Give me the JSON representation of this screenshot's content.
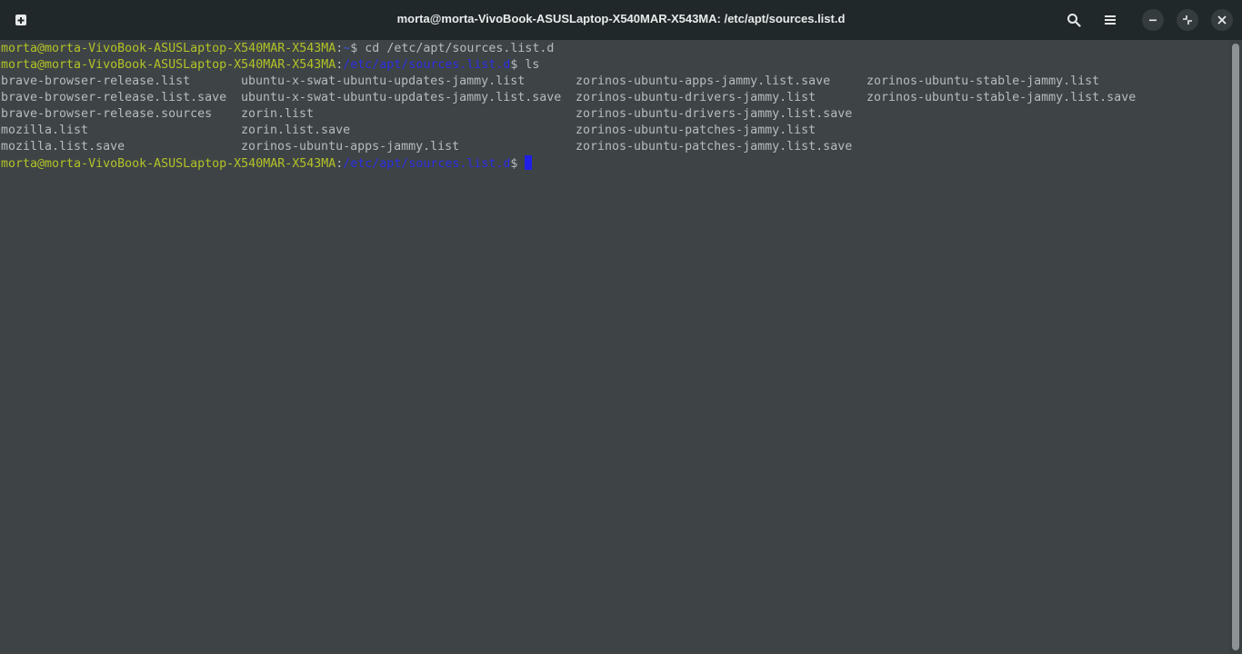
{
  "window": {
    "title": "morta@morta-VivoBook-ASUSLaptop-X540MAR-X543MA: /etc/apt/sources.list.d"
  },
  "headerbar": {
    "icons": [
      "new-tab-icon",
      "search-icon",
      "hamburger-menu-icon",
      "minimize-icon",
      "restore-icon",
      "close-icon"
    ]
  },
  "terminal": {
    "prompt_user": "morta@morta-VivoBook-ASUSLaptop-X540MAR-X543MA",
    "prompt_sep": ":",
    "prompt_dollar": "$",
    "lines": [
      {
        "path": "~",
        "command": " cd /etc/apt/sources.list.d"
      },
      {
        "path": "/etc/apt/sources.list.d",
        "command": " ls"
      }
    ],
    "ls_rows": [
      [
        "brave-browser-release.list",
        "ubuntu-x-swat-ubuntu-updates-jammy.list",
        "zorinos-ubuntu-apps-jammy.list.save",
        "zorinos-ubuntu-stable-jammy.list"
      ],
      [
        "brave-browser-release.list.save",
        "ubuntu-x-swat-ubuntu-updates-jammy.list.save",
        "zorinos-ubuntu-drivers-jammy.list",
        "zorinos-ubuntu-stable-jammy.list.save"
      ],
      [
        "brave-browser-release.sources",
        "zorin.list",
        "zorinos-ubuntu-drivers-jammy.list.save",
        ""
      ],
      [
        "mozilla.list",
        "zorin.list.save",
        "zorinos-ubuntu-patches-jammy.list",
        ""
      ],
      [
        "mozilla.list.save",
        "zorinos-ubuntu-apps-jammy.list",
        "zorinos-ubuntu-patches-jammy.list.save",
        ""
      ]
    ],
    "current_path": "/etc/apt/sources.list.d"
  },
  "colors": {
    "background": "#3e4446",
    "headerbar": "#21282a",
    "prompt_user": "#b3c227",
    "prompt_path": "#2b2ce0",
    "cursor": "#1f1fe6"
  }
}
